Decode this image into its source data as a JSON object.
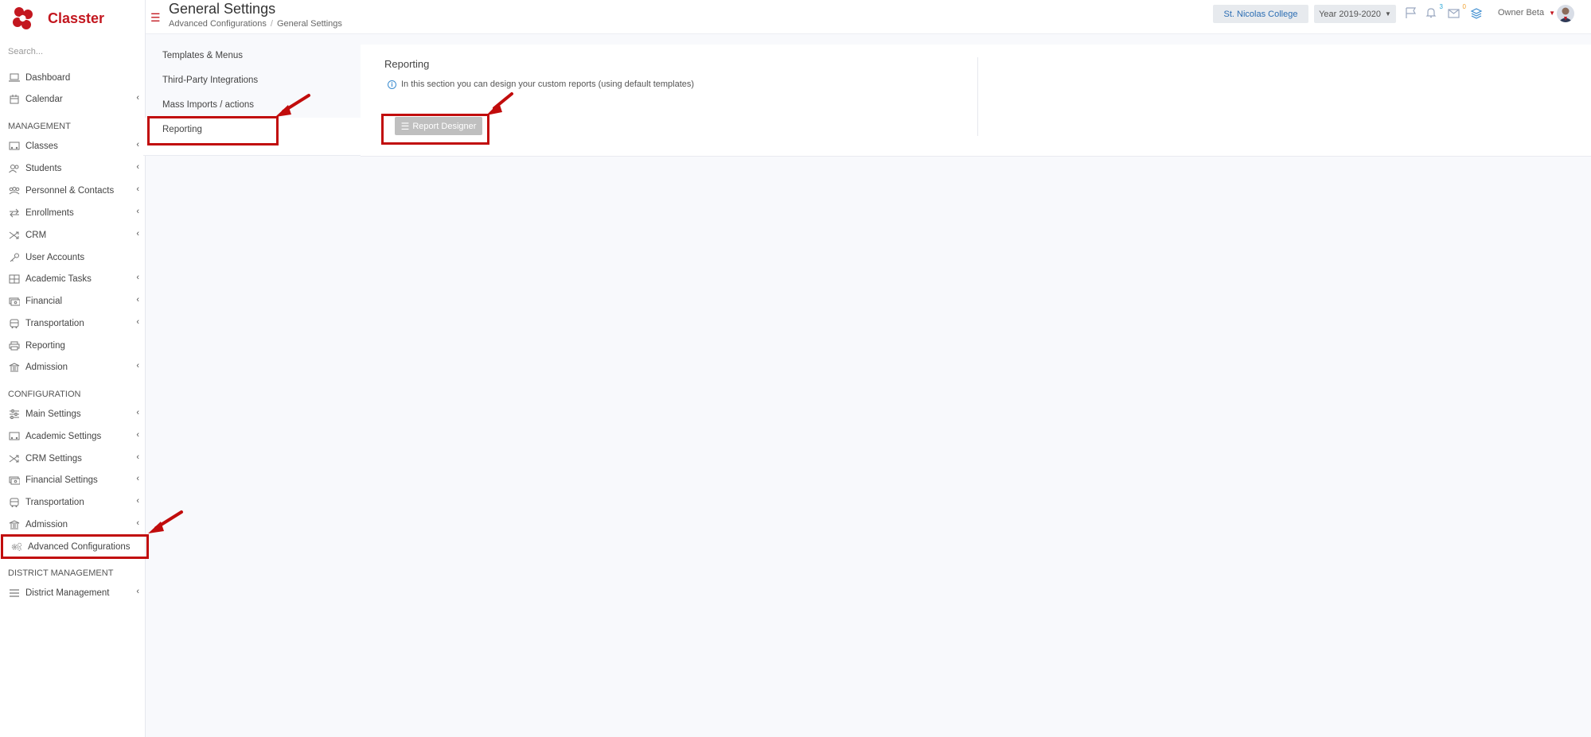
{
  "app": {
    "name": "Classter"
  },
  "sidebar": {
    "search_placeholder": "Search...",
    "top_items": [
      {
        "label": "Dashboard"
      },
      {
        "label": "Calendar"
      }
    ],
    "sections": {
      "management": "MANAGEMENT",
      "configuration": "CONFIGURATION",
      "district": "DISTRICT MANAGEMENT"
    },
    "management_items": [
      {
        "label": "Classes"
      },
      {
        "label": "Students"
      },
      {
        "label": "Personnel & Contacts"
      },
      {
        "label": "Enrollments"
      },
      {
        "label": "CRM"
      },
      {
        "label": "User Accounts"
      },
      {
        "label": "Academic Tasks"
      },
      {
        "label": "Financial"
      },
      {
        "label": "Transportation"
      },
      {
        "label": "Reporting"
      },
      {
        "label": "Admission"
      }
    ],
    "configuration_items": [
      {
        "label": "Main Settings"
      },
      {
        "label": "Academic Settings"
      },
      {
        "label": "CRM Settings"
      },
      {
        "label": "Financial Settings"
      },
      {
        "label": "Transportation"
      },
      {
        "label": "Admission"
      },
      {
        "label": "Advanced Configurations"
      }
    ],
    "district_items": [
      {
        "label": "District Management"
      }
    ]
  },
  "header": {
    "title": "General Settings",
    "breadcrumb": [
      "Advanced Configurations",
      "General Settings"
    ],
    "college": "St. Nicolas College",
    "year": "Year 2019-2020",
    "notification_count": "3",
    "message_count": "0",
    "user": "Owner Beta"
  },
  "subnav": {
    "items": [
      {
        "label": "Templates & Menus"
      },
      {
        "label": "Third-Party Integrations"
      },
      {
        "label": "Mass Imports / actions"
      },
      {
        "label": "Reporting"
      }
    ]
  },
  "main": {
    "title": "Reporting",
    "info": "In this section you can design your custom reports (using default templates)",
    "button_label": "Report Designer"
  },
  "colors": {
    "brand": "#c3171f",
    "highlight": "#c10c0c",
    "link": "#2b6db3"
  }
}
